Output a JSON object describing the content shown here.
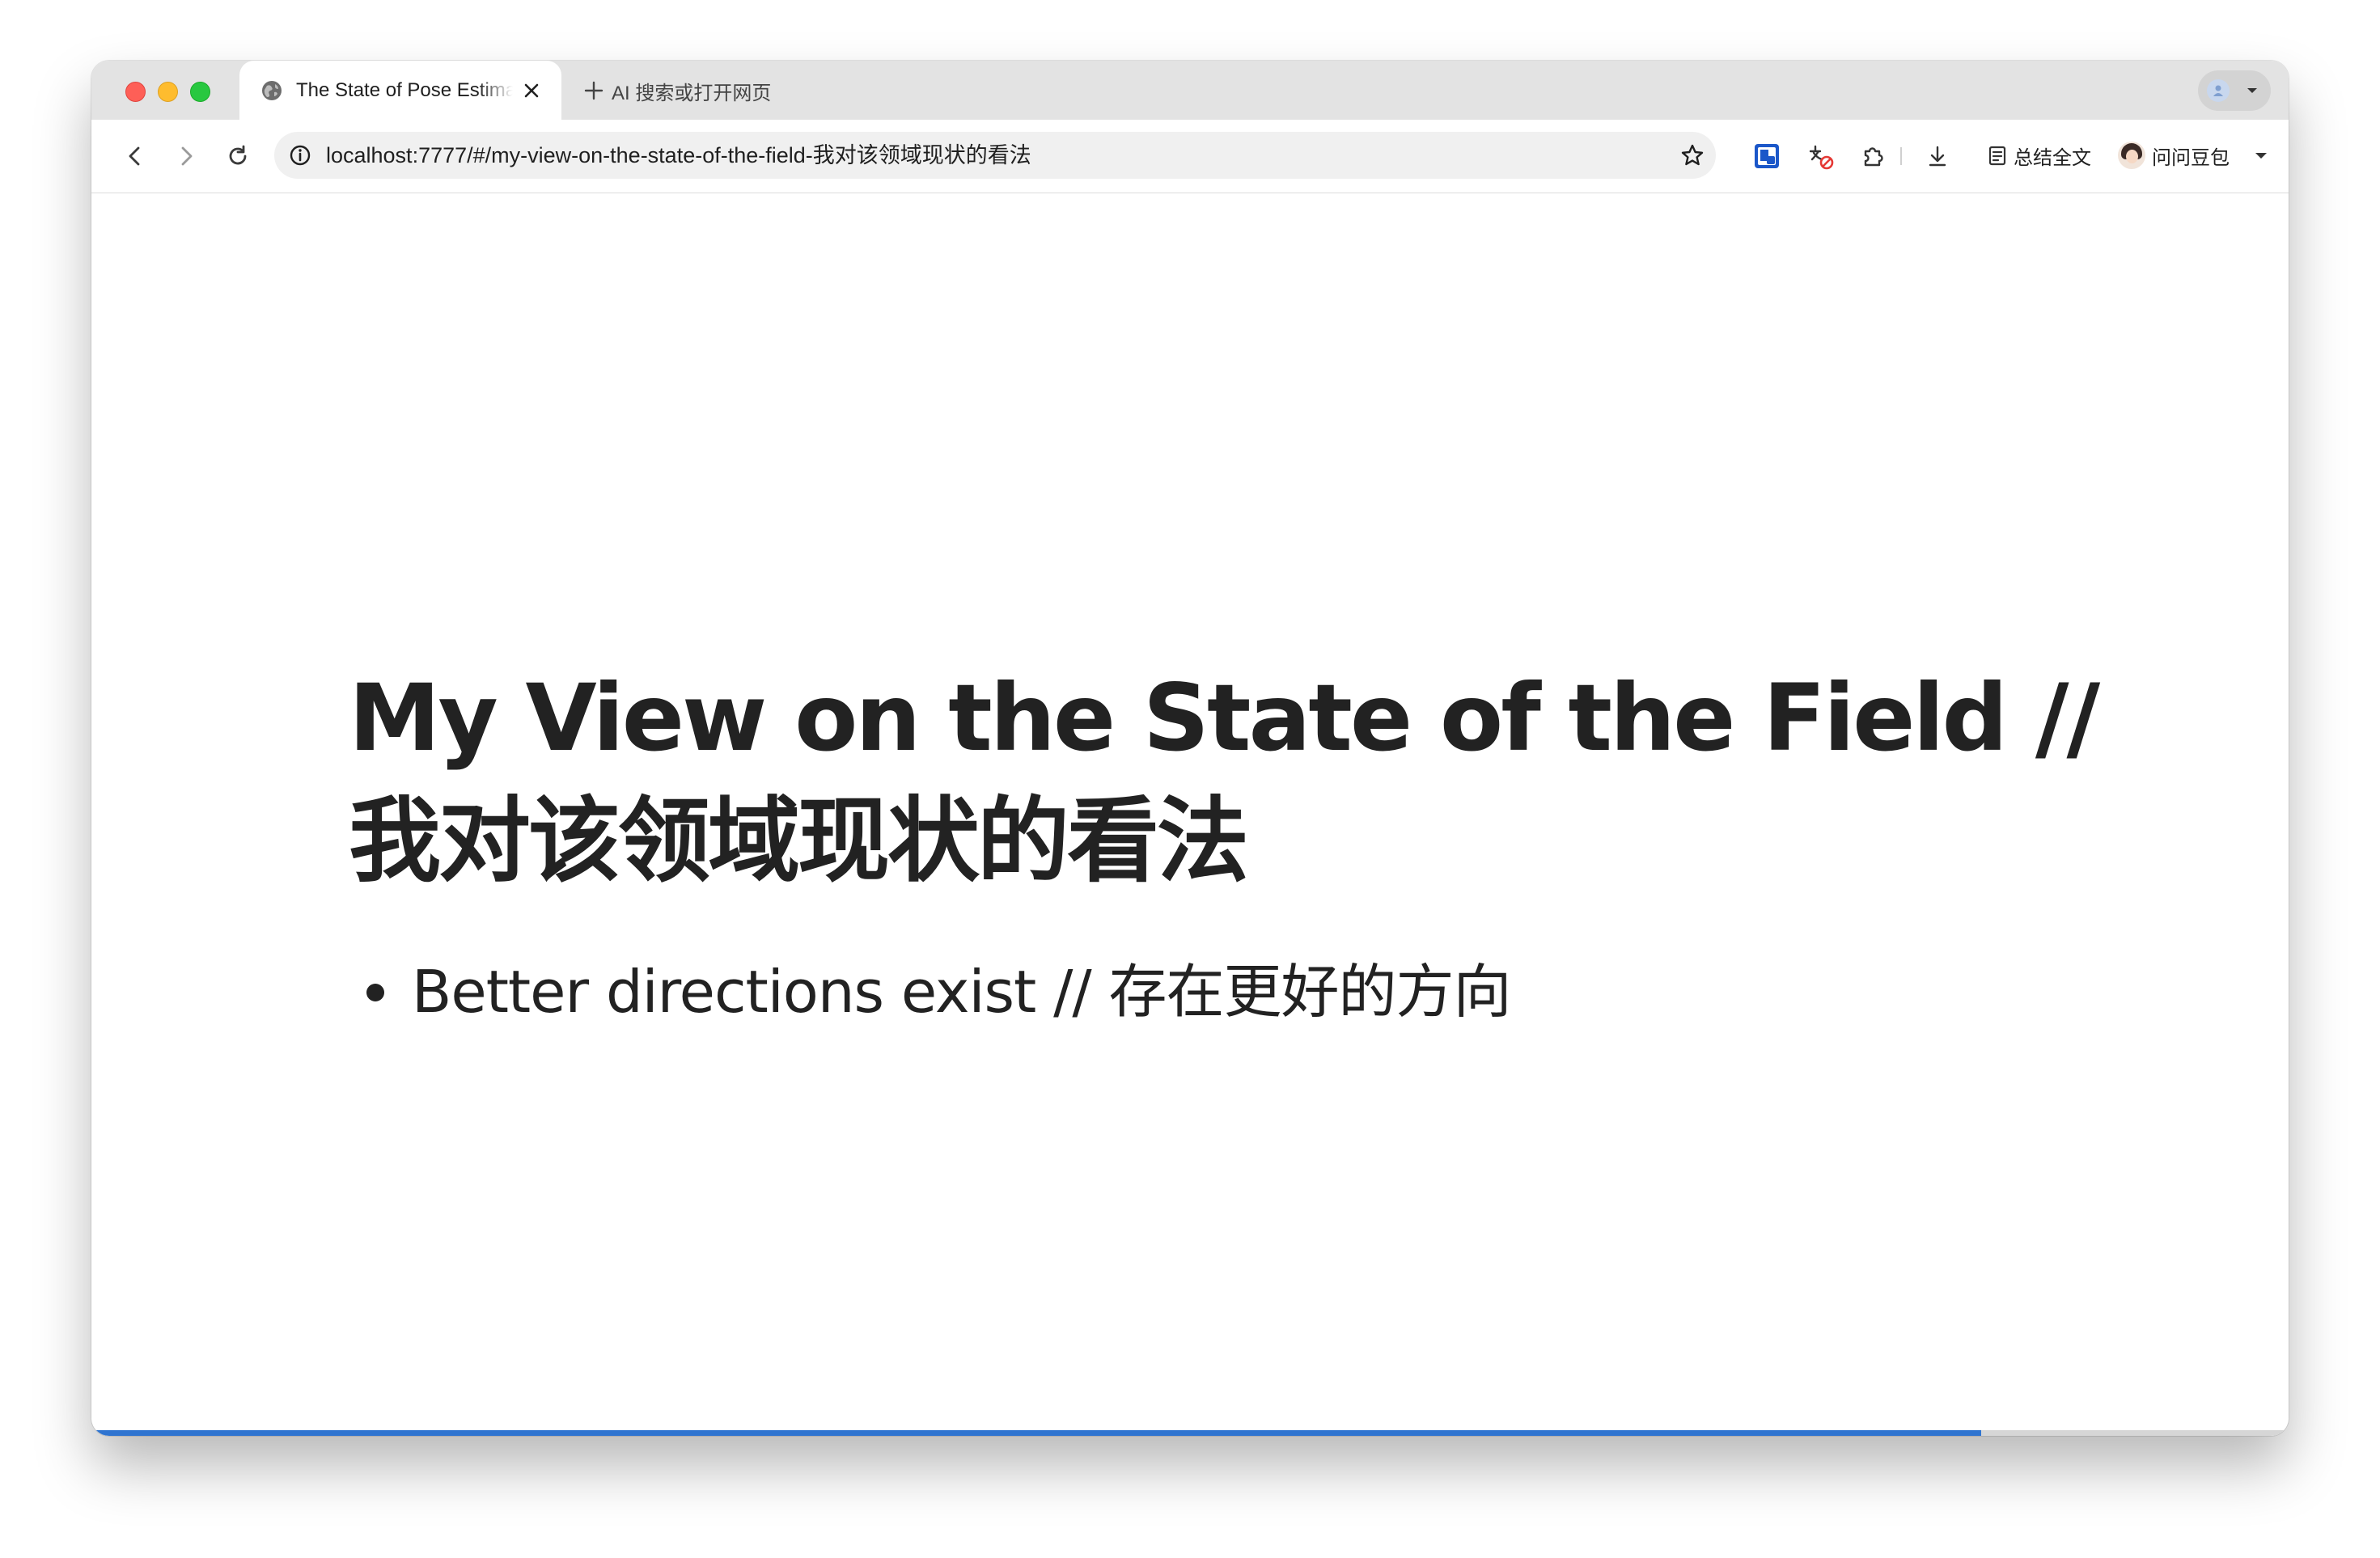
{
  "browser": {
    "tab": {
      "title": "The State of Pose Estimation",
      "favicon": "globe-icon",
      "close_icon": "close-icon"
    },
    "new_tab": {
      "icon": "plus-icon",
      "label": "AI 搜索或打开网页"
    },
    "profile": {
      "icon": "profile-icon"
    },
    "toolbar": {
      "back_icon": "back-arrow-icon",
      "forward_icon": "forward-arrow-icon",
      "reload_icon": "reload-icon",
      "url": "localhost:7777/#/my-view-on-the-state-of-the-field-我对该领域现状的看法",
      "site_info_icon": "info-icon",
      "bookmark_icon": "star-icon",
      "extension_icons": [
        "pin-extension-icon",
        "translate-off-icon",
        "extensions-puzzle-icon",
        "download-icon"
      ],
      "summary_label": "总结全文",
      "ask_label": "问问豆包"
    }
  },
  "slide": {
    "title": "My View on the State of the Field // 我对该领域现状的看法",
    "bullets": [
      "Better directions exist // 存在更好的方向"
    ],
    "progress": 0.86,
    "menu_icon": "hamburger-menu-icon"
  },
  "colors": {
    "accent": "#2f74d0",
    "title_text": "#222222",
    "tabstrip_bg": "#e3e3e3",
    "omnibox_bg": "#f0f0f0"
  }
}
